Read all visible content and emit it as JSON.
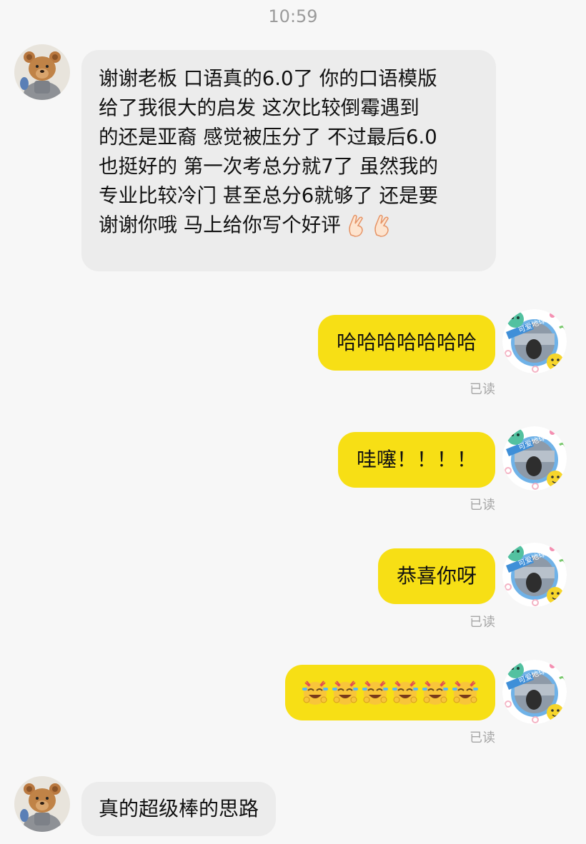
{
  "status_bar": {
    "time": "10:59"
  },
  "chat": {
    "messages": [
      {
        "id": "msg-1",
        "sender": "other",
        "text": "谢谢老板 口语真的6.0了 你的口语模版给了我很大的启发 这次比较倒霉遇到的还是亚裔 感觉被压分了 不过最后6.0也挺好的 第一次考总分就7了 虽然我的专业比较冷门 甚至总分6就够了 还是要谢谢你哦 马上给你写个好评",
        "lines": [
          "谢谢老板 口语真的6.0了 你的口语模版",
          "给了我很大的启发 这次比较倒霉遇到",
          "的还是亚裔 感觉被压分了 不过最后6.0",
          "也挺好的 第一次考总分就7了 虽然我的",
          "专业比较冷门 甚至总分6就够了 还是要",
          "谢谢你哦 马上给你写个好评"
        ],
        "trailing_emoji": [
          "fingers-crossed-icon",
          "fingers-crossed-icon"
        ]
      },
      {
        "id": "msg-2",
        "sender": "self",
        "text": "哈哈哈哈哈哈哈",
        "status": "已读"
      },
      {
        "id": "msg-3",
        "sender": "self",
        "text": "哇噻！！！！",
        "status": "已读"
      },
      {
        "id": "msg-4",
        "sender": "self",
        "text": "恭喜你呀",
        "status": "已读"
      },
      {
        "id": "msg-5",
        "sender": "self",
        "emoji": [
          "tears-of-joy-icon",
          "tears-of-joy-icon",
          "tears-of-joy-icon",
          "tears-of-joy-icon",
          "tears-of-joy-icon",
          "tears-of-joy-icon"
        ],
        "status": "已读"
      },
      {
        "id": "msg-6",
        "sender": "other",
        "text": "真的超级棒的思路"
      }
    ]
  },
  "avatars": {
    "other": {
      "icon": "teddy-bear-avatar"
    },
    "self": {
      "icon": "lovely-earth-avatar",
      "badge_text": "可爱地球"
    }
  },
  "colors": {
    "background": "#f7f7f7",
    "incoming_bubble": "#ececec",
    "outgoing_bubble": "#f7df15",
    "read_status": "#a5a5a5",
    "time": "#9b9b9b"
  }
}
